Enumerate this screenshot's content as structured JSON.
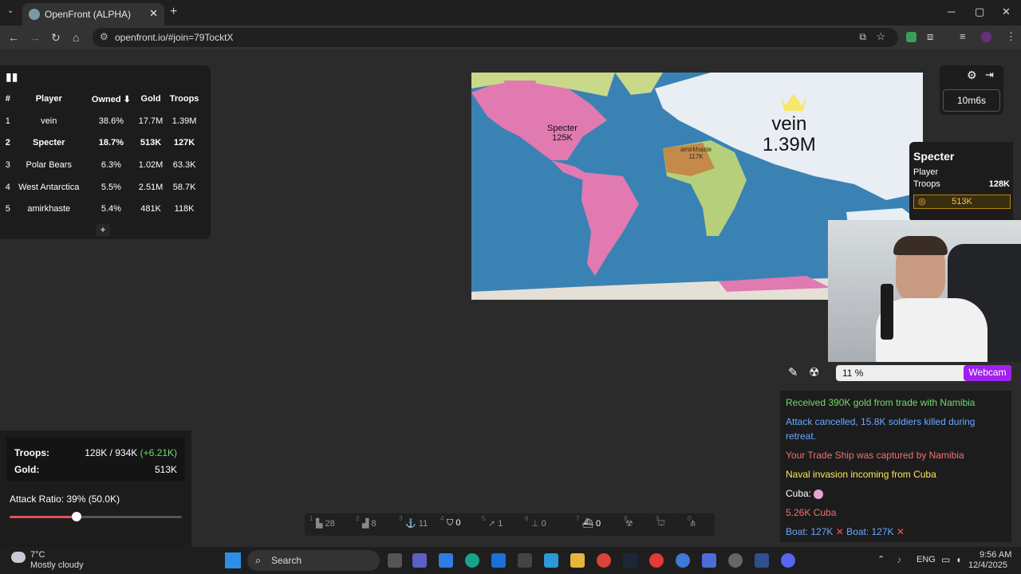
{
  "browser": {
    "tab_title": "OpenFront (ALPHA)",
    "new_tab": "+",
    "close_tab": "✕",
    "url": "openfront.io/#join=79TocktX",
    "window_minimize": "─",
    "window_maximize": "▢",
    "window_close": "✕"
  },
  "leaderboard": {
    "headers": [
      "#",
      "Player",
      "Owned ⬇",
      "Gold",
      "Troops"
    ],
    "rows": [
      [
        "1",
        "vein",
        "38.6%",
        "17.7M",
        "1.39M"
      ],
      [
        "2",
        "Specter",
        "18.7%",
        "513K",
        "127K"
      ],
      [
        "3",
        "Polar Bears",
        "6.3%",
        "1.02M",
        "63.3K"
      ],
      [
        "4",
        "West Antarctica",
        "5.5%",
        "2.51M",
        "58.7K"
      ],
      [
        "5",
        "amirkhaste",
        "5.4%",
        "481K",
        "118K"
      ]
    ],
    "expand": "+"
  },
  "map": {
    "labels": [
      {
        "name": "Specter",
        "troops": "125K"
      },
      {
        "name": "vein",
        "troops": "1.39M"
      },
      {
        "name": "amirkhaste",
        "troops": "117K"
      }
    ]
  },
  "timer": "10m6s",
  "player_info": {
    "name": "Specter",
    "type": "Player",
    "troops_label": "Troops",
    "troops_value": "128K",
    "gold": "513K"
  },
  "webcam": {
    "percent": "11 %",
    "label": "Webcam"
  },
  "events": [
    {
      "text": "Received 390K gold from trade with Namibia",
      "color": "#6fdc6f"
    },
    {
      "text": "Attack cancelled, 15.8K soldiers killed during",
      "color": "#6aa8ff"
    },
    {
      "text": "retreat.",
      "color": "#6aa8ff"
    },
    {
      "text": "Your Trade Ship was captured by Namibia",
      "color": "#f07070"
    },
    {
      "text": "Naval invasion incoming from Cuba",
      "color": "#ffe65a"
    },
    {
      "text": "Cuba:",
      "color": "#ffffff"
    },
    {
      "text": "5.26K Cuba",
      "color": "#f07070"
    },
    {
      "text": "Boat: 127K",
      "color": "#6aa8ff"
    },
    {
      "text": "Boat: 127K",
      "color": "#6aa8ff"
    }
  ],
  "stats": {
    "troops_label": "Troops:",
    "troops_value": "128K / 934K",
    "troops_delta": "(+6.21K)",
    "gold_label": "Gold:",
    "gold_value": "513K",
    "attack_ratio": "Attack Ratio: 39% (50.0K)",
    "attack_fraction": 0.39
  },
  "build_bar": [
    {
      "key": "1",
      "count": "28",
      "icon": "city-icon"
    },
    {
      "key": "2",
      "count": "8",
      "icon": "factory-icon"
    },
    {
      "key": "3",
      "count": "11",
      "icon": "port-icon"
    },
    {
      "key": "4",
      "count": "0",
      "icon": "defense-icon"
    },
    {
      "key": "5",
      "count": "1",
      "icon": "missile-silo-icon"
    },
    {
      "key": "6",
      "count": "0",
      "icon": "sam-icon"
    },
    {
      "key": "7",
      "count": "0",
      "icon": "warship-icon"
    },
    {
      "key": "8",
      "count": "",
      "icon": "atom-bomb-icon"
    },
    {
      "key": "9",
      "count": "",
      "icon": "hydrogen-bomb-icon"
    },
    {
      "key": "0",
      "count": "",
      "icon": "mirv-icon"
    }
  ],
  "taskbar": {
    "weather_temp": "7°C",
    "weather_desc": "Mostly cloudy",
    "search": "Search",
    "lang": "ENG",
    "time": "9:56 AM",
    "date": "12/4/2025"
  }
}
